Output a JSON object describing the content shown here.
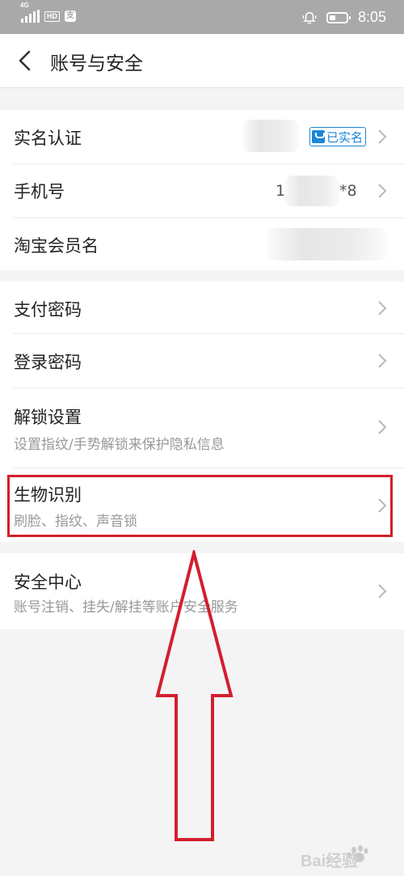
{
  "status_bar": {
    "network": "4G",
    "hd": "HD",
    "app_badge": "支",
    "time": "8:05"
  },
  "header": {
    "title": "账号与安全"
  },
  "groups": [
    {
      "items": [
        {
          "label": "实名认证",
          "value_masked": true,
          "badge": "已实名"
        },
        {
          "label": "手机号",
          "value_start": "1",
          "value_end": "*8"
        },
        {
          "label": "淘宝会员名",
          "value_masked": true
        }
      ]
    },
    {
      "items": [
        {
          "label": "支付密码"
        },
        {
          "label": "登录密码"
        },
        {
          "label": "解锁设置",
          "subtitle": "设置指纹/手势解锁来保护隐私信息"
        },
        {
          "label": "生物识别",
          "subtitle": "刷脸、指纹、声音锁",
          "highlighted": true
        }
      ]
    },
    {
      "items": [
        {
          "label": "安全中心",
          "subtitle": "账号注销、挂失/解挂等账户安全服务"
        }
      ]
    }
  ],
  "watermark": {
    "text": "Bai经验"
  },
  "colors": {
    "highlight": "#d21f2e",
    "badge_blue": "#1a86d8",
    "status_bar": "#a9a9a9"
  }
}
